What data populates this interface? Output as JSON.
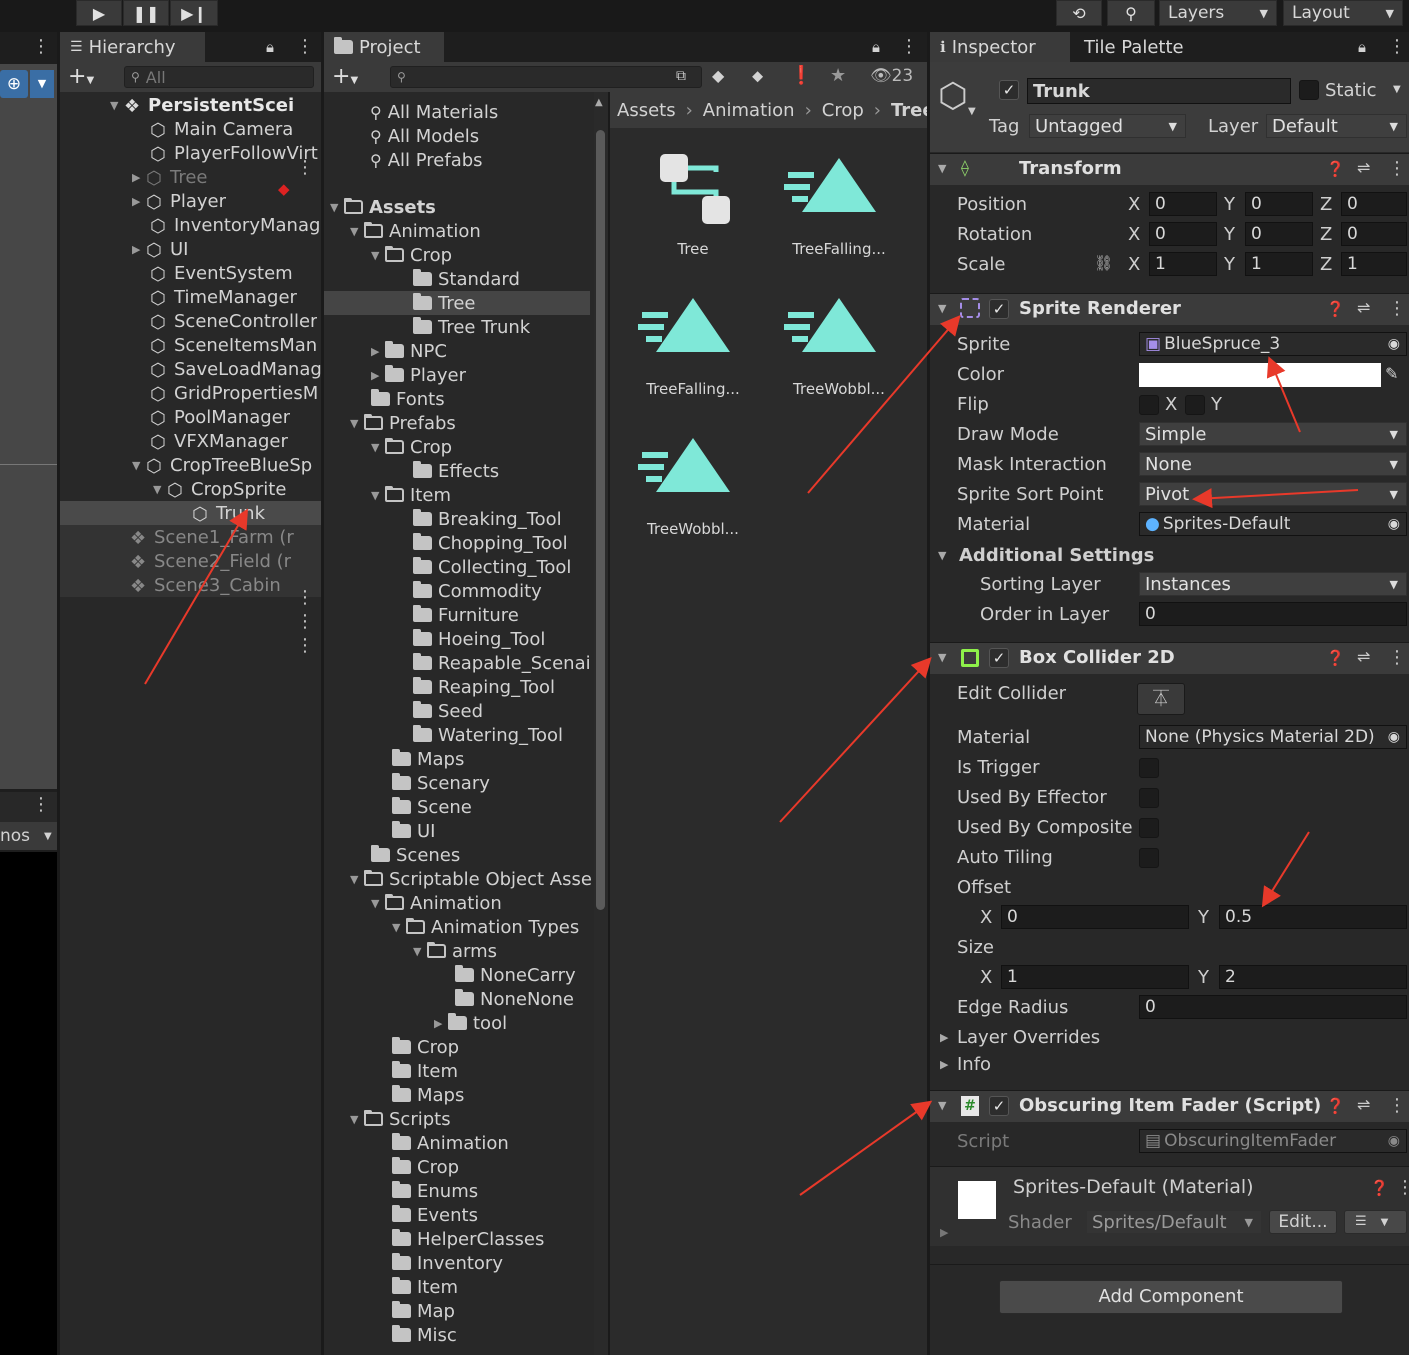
{
  "toolbar": {
    "play_icon": "play-icon",
    "pause_icon": "pause-icon",
    "step_icon": "step-icon",
    "history_icon": "history-icon",
    "search_icon": "search-icon",
    "layers_label": "Layers",
    "layout_label": "Layout"
  },
  "scene_strip": {
    "gizmos_partial": "nos"
  },
  "hierarchy": {
    "tab_label": "Hierarchy",
    "search_placeholder": "All",
    "items": [
      {
        "label": "PersistentScei",
        "bold": true
      },
      {
        "label": "Main Camera"
      },
      {
        "label": "PlayerFollowVirt"
      },
      {
        "label": "Tree"
      },
      {
        "label": "Player"
      },
      {
        "label": "InventoryManag"
      },
      {
        "label": "UI"
      },
      {
        "label": "EventSystem"
      },
      {
        "label": "TimeManager"
      },
      {
        "label": "SceneController"
      },
      {
        "label": "SceneItemsMan"
      },
      {
        "label": "SaveLoadManag"
      },
      {
        "label": "GridPropertiesM"
      },
      {
        "label": "PoolManager"
      },
      {
        "label": "VFXManager"
      },
      {
        "label": "CropTreeBlueSp"
      },
      {
        "label": "CropSprite"
      },
      {
        "label": "Trunk"
      },
      {
        "label": "Scene1_Farm (r"
      },
      {
        "label": "Scene2_Field (r"
      },
      {
        "label": "Scene3_Cabin"
      }
    ]
  },
  "project": {
    "tab_label": "Project",
    "hidden_count": "23",
    "favorites": [
      "All Materials",
      "All Models",
      "All Prefabs"
    ],
    "tree": [
      "Assets",
      "Animation",
      "Crop",
      "Standard",
      "Tree",
      "Tree Trunk",
      "NPC",
      "Player",
      "Fonts",
      "Prefabs",
      "Crop",
      "Effects",
      "Item",
      "Breaking_Tool",
      "Chopping_Tool",
      "Collecting_Tool",
      "Commodity",
      "Furniture",
      "Hoeing_Tool",
      "Reapable_Scenai",
      "Reaping_Tool",
      "Seed",
      "Watering_Tool",
      "Maps",
      "Scenary",
      "Scene",
      "UI",
      "Scenes",
      "Scriptable Object Asse",
      "Animation",
      "Animation Types",
      "arms",
      "NoneCarry",
      "NoneNone",
      "tool",
      "Crop",
      "Item",
      "Maps",
      "Scripts",
      "Animation",
      "Crop",
      "Enums",
      "Events",
      "HelperClasses",
      "Inventory",
      "Item",
      "Map",
      "Misc"
    ],
    "breadcrumb": [
      "Assets",
      "Animation",
      "Crop",
      "Tree"
    ],
    "assets": [
      "Tree",
      "TreeFalling...",
      "TreeFalling...",
      "TreeWobbl...",
      "TreeWobbl..."
    ]
  },
  "inspector": {
    "tab_label": "Inspector",
    "tab2_label": "Tile Palette",
    "object_name": "Trunk",
    "static_label": "Static",
    "tag_label": "Tag",
    "tag_value": "Untagged",
    "layer_label": "Layer",
    "layer_value": "Default",
    "transform": {
      "title": "Transform",
      "position_label": "Position",
      "rotation_label": "Rotation",
      "scale_label": "Scale",
      "position": [
        "0",
        "0",
        "0"
      ],
      "rotation": [
        "0",
        "0",
        "0"
      ],
      "scale": [
        "1",
        "1",
        "1"
      ],
      "x": "X",
      "y": "Y",
      "z": "Z"
    },
    "sprite_renderer": {
      "title": "Sprite Renderer",
      "sprite_label": "Sprite",
      "sprite_value": "BlueSpruce_3",
      "color_label": "Color",
      "color_value": "#ffffff",
      "flip_label": "Flip",
      "flip_x": "X",
      "flip_y": "Y",
      "draw_mode_label": "Draw Mode",
      "draw_mode_value": "Simple",
      "mask_label": "Mask Interaction",
      "mask_value": "None",
      "sort_point_label": "Sprite Sort Point",
      "sort_point_value": "Pivot",
      "material_label": "Material",
      "material_value": "Sprites-Default",
      "additional_label": "Additional Settings",
      "sorting_layer_label": "Sorting Layer",
      "sorting_layer_value": "Instances",
      "order_label": "Order in Layer",
      "order_value": "0"
    },
    "box_collider": {
      "title": "Box Collider 2D",
      "edit_collider_label": "Edit Collider",
      "material_label": "Material",
      "material_value": "None (Physics Material 2D)",
      "is_trigger_label": "Is Trigger",
      "effector_label": "Used By Effector",
      "composite_label": "Used By Composite",
      "auto_tiling_label": "Auto Tiling",
      "offset_label": "Offset",
      "offset_x": "0",
      "offset_y": "0.5",
      "size_label": "Size",
      "size_x": "1",
      "size_y": "2",
      "edge_radius_label": "Edge Radius",
      "edge_radius_value": "0",
      "layer_overrides_label": "Layer Overrides",
      "info_label": "Info"
    },
    "script": {
      "title": "Obscuring Item Fader (Script)",
      "script_label": "Script",
      "script_value": "ObscuringItemFader"
    },
    "material": {
      "title": "Sprites-Default (Material)",
      "shader_label": "Shader",
      "shader_value": "Sprites/Default",
      "edit_label": "Edit..."
    },
    "add_component_label": "Add Component"
  },
  "colors": {
    "accent_teal": "#7fe8d8",
    "annotation_red": "#e8392a",
    "selection": "#3e3e3e"
  }
}
